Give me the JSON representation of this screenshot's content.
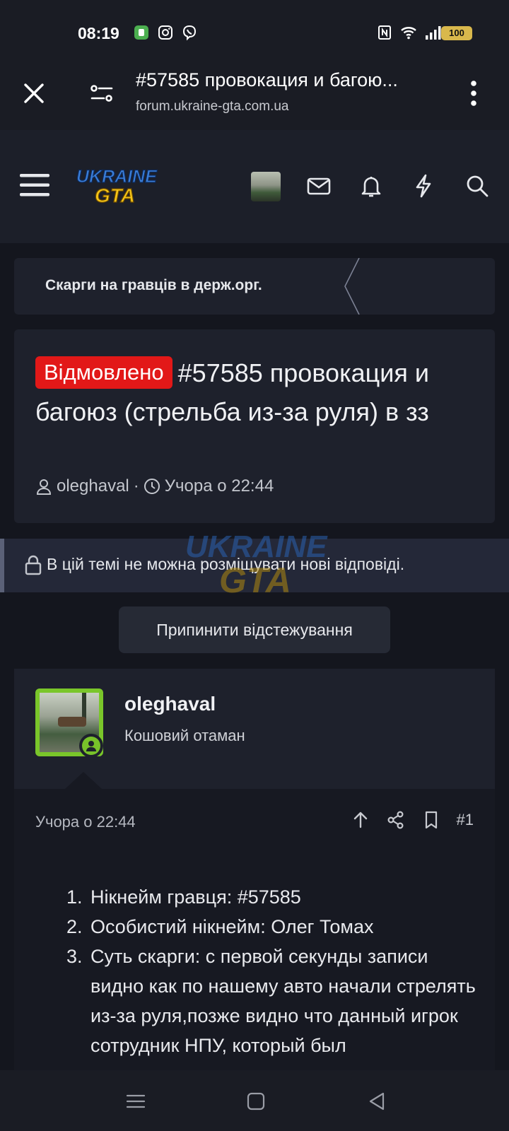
{
  "status_bar": {
    "time": "08:19",
    "battery": "100",
    "icons": [
      "app-icon",
      "instagram-icon",
      "viber-icon",
      "nfc-icon",
      "wifi-icon",
      "signal-icon",
      "signal-icon"
    ]
  },
  "browser": {
    "title": "#57585 провокация и багою...",
    "url": "forum.ukraine-gta.com.ua"
  },
  "header": {
    "logo_line1": "UKRAINE",
    "logo_line2": "GTA"
  },
  "breadcrumb": {
    "label": "Скарги на гравців в держ.орг."
  },
  "thread": {
    "badge": "Відмовлено",
    "title": "#57585 провокация и багоюз (стрельба из-за руля) в зз",
    "author": "oleghaval",
    "separator": "·",
    "time": "Учора о 22:44"
  },
  "notice": {
    "text": "В цій темі не можна розміщувати нові відповіді."
  },
  "unwatch_button": "Припинити відстежування",
  "post": {
    "username": "oleghaval",
    "role": "Кошовий отаман",
    "date": "Учора о 22:44",
    "number": "#1",
    "items": [
      {
        "num": "1.",
        "text": "Нікнейм гравця: #57585"
      },
      {
        "num": "2.",
        "text": "Особистий нікнейм: Олег Томах"
      },
      {
        "num": "3.",
        "text": "Суть скарги: с первой секунды записи видно как по нашему авто начали стрелять из-за руля,позже видно что данный игрок сотрудник НПУ, который был"
      }
    ]
  },
  "colors": {
    "badge": "#e21818",
    "online": "#78c22a",
    "background": "#14161e"
  }
}
